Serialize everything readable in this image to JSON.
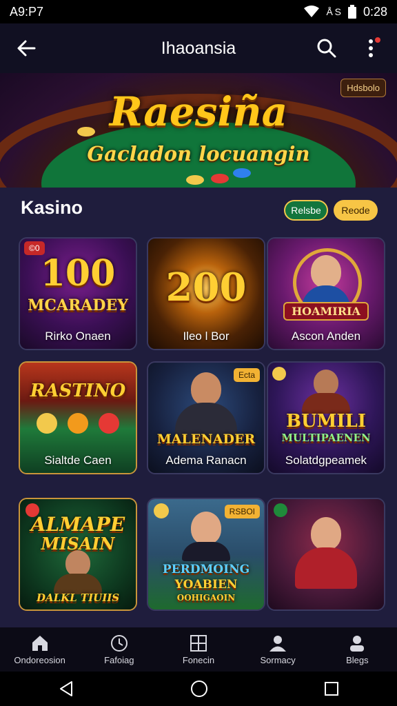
{
  "status_bar": {
    "time": "A9:P7",
    "indicators": "Å S",
    "clock": "0:28"
  },
  "app_bar": {
    "title": "Ihaoansia",
    "back_icon": "arrow-left-icon",
    "search_icon": "search-icon",
    "menu_icon": "more-vertical-icon"
  },
  "banner": {
    "title": "Raesiña",
    "subtitle": "Gacladon locuangin",
    "badge": "Hdsbolo"
  },
  "section": {
    "title": "Kasino",
    "filters": [
      {
        "label": "Relsbe"
      },
      {
        "label": "Reode"
      }
    ]
  },
  "cards": [
    {
      "caption": "Rirko Onaen",
      "big": "100",
      "sub": "MCARADEY",
      "tag": "©0"
    },
    {
      "caption": "Ileo l Bor",
      "big": "200"
    },
    {
      "caption": "Ascon Anden",
      "banner": "HOAMIRIA"
    },
    {
      "caption": "Sialtde Caen",
      "big": "RASTINO"
    },
    {
      "caption": "Adema Ranacn",
      "big": "MALENADER",
      "tag": "Ecta"
    },
    {
      "caption": "Solatdgpeamek",
      "big": "BUMILI",
      "sub": "MULTIPAENEN"
    },
    {
      "caption": "",
      "big": "ALMAPE",
      "sub": "MISAIN",
      "sub2": "DALKL TIUIIS"
    },
    {
      "caption": "",
      "big": "PERDMOING",
      "sub": "YOABIEN",
      "sub2": "OOHIGAOIN",
      "tag": "RSBOI"
    },
    {
      "caption": ""
    }
  ],
  "bottom_nav": [
    {
      "label": "Ondoreosion",
      "icon": "home-icon"
    },
    {
      "label": "Fafoiag",
      "icon": "clock-icon"
    },
    {
      "label": "Fonecin",
      "icon": "grid-icon"
    },
    {
      "label": "Sormacy",
      "icon": "people-icon"
    },
    {
      "label": "Blegs",
      "icon": "user-icon"
    }
  ],
  "system_nav": {
    "back": "back-triangle-icon",
    "home": "home-circle-icon",
    "recents": "recents-square-icon"
  }
}
